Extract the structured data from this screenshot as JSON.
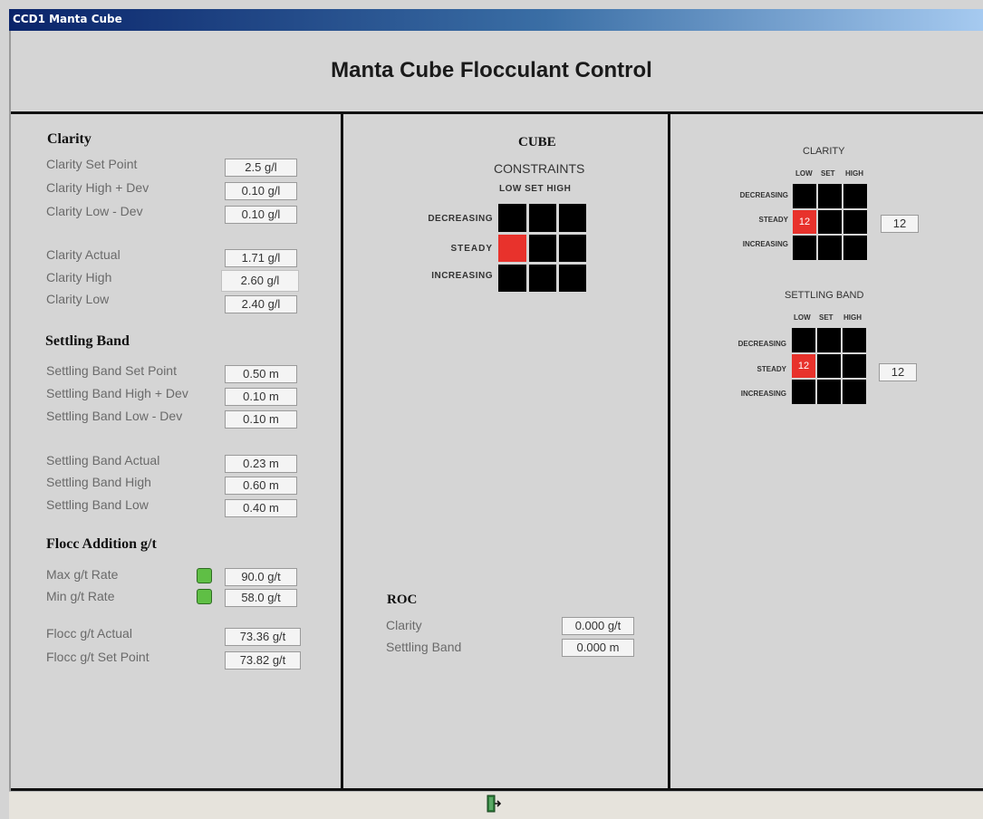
{
  "window": {
    "title": "CCD1 Manta Cube"
  },
  "app_title": "Manta Cube Flocculant Control",
  "left": {
    "clarity": {
      "heading": "Clarity",
      "rows": [
        {
          "label": "Clarity Set Point",
          "value": "2.5 g/l"
        },
        {
          "label": "Clarity High + Dev",
          "value": "0.10 g/l"
        },
        {
          "label": "Clarity Low - Dev",
          "value": "0.10 g/l"
        },
        {
          "label": "Clarity Actual",
          "value": "1.71 g/l"
        },
        {
          "label": "Clarity High",
          "value": "2.60 g/l"
        },
        {
          "label": "Clarity Low",
          "value": "2.40 g/l"
        }
      ]
    },
    "settling": {
      "heading": "Settling Band",
      "rows": [
        {
          "label": "Settling Band Set Point",
          "value": "0.50 m"
        },
        {
          "label": "Settling Band High + Dev",
          "value": "0.10 m"
        },
        {
          "label": "Settling Band Low - Dev",
          "value": "0.10 m"
        },
        {
          "label": "Settling Band Actual",
          "value": "0.23 m"
        },
        {
          "label": "Settling Band High",
          "value": "0.60 m"
        },
        {
          "label": "Settling Band Low",
          "value": "0.40 m"
        }
      ]
    },
    "flocc": {
      "heading": "Flocc Addition g/t",
      "rows": [
        {
          "label": "Max g/t Rate",
          "value": "90.0 g/t"
        },
        {
          "label": "Min g/t Rate",
          "value": "58.0 g/t"
        },
        {
          "label": "Flocc g/t Actual",
          "value": "73.36 g/t"
        },
        {
          "label": "Flocc g/t Set Point",
          "value": "73.82 g/t"
        }
      ]
    }
  },
  "middle": {
    "cube_title": "CUBE",
    "cube_subtitle": "CONSTRAINTS",
    "col_labels": "LOW SET HIGH",
    "row_labels": [
      "DECREASING",
      "STEADY",
      "INCREASING"
    ],
    "roc": {
      "heading": "ROC",
      "rows": [
        {
          "label": "Clarity",
          "value": "0.000 g/t"
        },
        {
          "label": "Settling Band",
          "value": "0.000 m"
        }
      ]
    }
  },
  "right": {
    "clarity": {
      "title": "CLARITY",
      "cols": [
        "LOW",
        "SET",
        "HIGH"
      ],
      "rows": [
        "DECREASING",
        "STEADY",
        "INCREASING"
      ],
      "cell_value": "12",
      "output": "12"
    },
    "settling": {
      "title": "SETTLING BAND",
      "cols": [
        "LOW",
        "SET",
        "HIGH"
      ],
      "rows": [
        "DECREASING",
        "STEADY",
        "INCREASING"
      ],
      "cell_value": "12",
      "output": "12"
    }
  },
  "colors": {
    "active_cell": "#e8322c",
    "indicator": "#5fbf45"
  }
}
